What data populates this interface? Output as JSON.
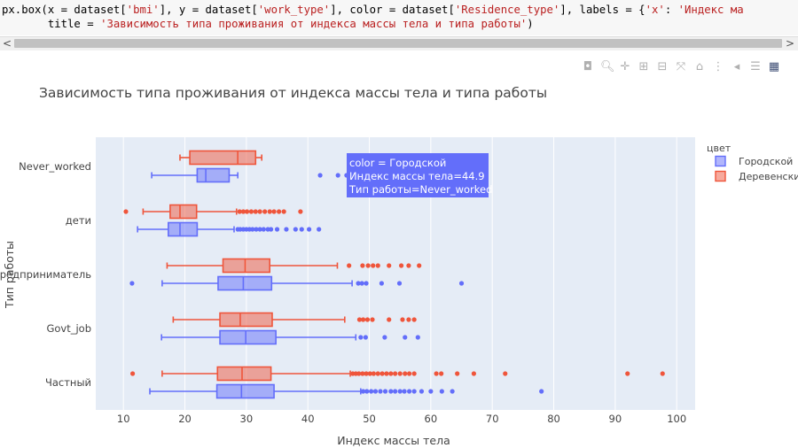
{
  "code": {
    "line1_pre": "px.box(x = dataset[",
    "line1_s1": "'bmi'",
    "line1_mid1": "], y = dataset[",
    "line1_s2": "'work_type'",
    "line1_mid2": "], color = dataset[",
    "line1_s3": "'Residence_type'",
    "line1_mid3": "], labels = {",
    "line1_s4": "'x'",
    "line1_mid4": ": ",
    "line1_s5": "'Индекс ма",
    "line2_pre": "       title = ",
    "line2_s": "'Зависимость типа проживания от индекса массы тела и типа работы'",
    "line2_post": ")"
  },
  "scroll": {
    "left_arrow": "<",
    "right_arrow": ">"
  },
  "modebar": [
    "camera-icon",
    "zoom-icon",
    "pan-icon",
    "zoom-in-icon",
    "zoom-out-icon",
    "autoscale-icon",
    "reset-axes-icon",
    "spike-lines-icon",
    "hover-closest-icon",
    "hover-compare-icon",
    "plotly-logo-icon"
  ],
  "tooltip": {
    "line1": "color = Городской",
    "line2": "Индекс массы тела=44.9",
    "line3": "Тип работы=Never_worked"
  },
  "chart_data": {
    "type": "box",
    "orientation": "horizontal",
    "title": "Зависимость типа проживания от индекса массы тела и типа работы",
    "xlabel": "Индекс массы тела",
    "ylabel": "Тип работы",
    "xlim": [
      5.5,
      103
    ],
    "xticks": [
      10,
      20,
      30,
      40,
      50,
      60,
      70,
      80,
      90,
      100
    ],
    "categories": [
      "Never_worked",
      "дети",
      "Предприниматель",
      "Govt_job",
      "Частный"
    ],
    "category_labels": [
      "Never_worked",
      "дети",
      "Предприниматель",
      "Govt_job",
      "Частный"
    ],
    "legend": {
      "title": "цвет",
      "placement": "right"
    },
    "series": [
      {
        "name": "Городской",
        "color": "#636efa",
        "boxes": [
          {
            "category": "Never_worked",
            "whisker_low": 14.6,
            "q1": 22.0,
            "median": 23.4,
            "q3": 27.2,
            "whisker_high": 28.6,
            "outliers": [
              42.0,
              44.9,
              46.3
            ]
          },
          {
            "category": "дети",
            "whisker_low": 12.3,
            "q1": 17.3,
            "median": 19.2,
            "q3": 22.0,
            "whisker_high": 28.0,
            "outliers": [
              28.6,
              29.0,
              29.5,
              30.0,
              30.5,
              31.0,
              31.6,
              32.2,
              32.8,
              33.5,
              34.0,
              35.0,
              36.5,
              38.0,
              39.0,
              40.2,
              41.8
            ]
          },
          {
            "category": "Предприниматель",
            "whisker_low": 16.3,
            "q1": 25.4,
            "median": 29.5,
            "q3": 34.1,
            "whisker_high": 47.2,
            "outliers": [
              11.4,
              48.2,
              48.8,
              49.5,
              52.0,
              54.9,
              65.0
            ]
          },
          {
            "category": "Govt_job",
            "whisker_low": 16.2,
            "q1": 25.7,
            "median": 29.9,
            "q3": 34.8,
            "whisker_high": 47.8,
            "outliers": [
              48.6,
              49.4,
              52.5,
              55.8,
              57.9
            ]
          },
          {
            "category": "Частный",
            "whisker_low": 14.3,
            "q1": 25.2,
            "median": 29.2,
            "q3": 34.5,
            "whisker_high": 48.6,
            "outliers": [
              49.0,
              49.6,
              50.3,
              51.0,
              51.8,
              52.6,
              53.5,
              54.2,
              55.0,
              55.7,
              56.5,
              57.3,
              58.5,
              60.0,
              61.8,
              63.5,
              78.0
            ]
          }
        ]
      },
      {
        "name": "Деревенский",
        "color": "#ef553b",
        "boxes": [
          {
            "category": "Never_worked",
            "whisker_low": 19.2,
            "q1": 20.8,
            "median": 28.6,
            "q3": 31.5,
            "whisker_high": 32.5,
            "outliers": []
          },
          {
            "category": "дети",
            "whisker_low": 13.2,
            "q1": 17.6,
            "median": 19.2,
            "q3": 21.9,
            "whisker_high": 28.4,
            "outliers": [
              10.4,
              28.9,
              29.5,
              30.1,
              30.8,
              31.5,
              32.2,
              33.0,
              33.8,
              34.5,
              35.3,
              36.1,
              38.8
            ]
          },
          {
            "category": "Предприниматель",
            "whisker_low": 17.1,
            "q1": 26.2,
            "median": 29.8,
            "q3": 33.8,
            "whisker_high": 44.8,
            "outliers": [
              46.7,
              48.9,
              49.8,
              50.6,
              51.4,
              53.2,
              55.2,
              56.4,
              58.1
            ]
          },
          {
            "category": "Govt_job",
            "whisker_low": 18.1,
            "q1": 25.7,
            "median": 29.0,
            "q3": 34.2,
            "whisker_high": 46.0,
            "outliers": [
              48.4,
              49.0,
              49.7,
              50.5,
              53.2,
              55.4,
              56.4,
              57.3
            ]
          },
          {
            "category": "Частный",
            "whisker_low": 16.3,
            "q1": 25.3,
            "median": 29.3,
            "q3": 34.0,
            "whisker_high": 46.9,
            "outliers": [
              11.5,
              47.3,
              47.8,
              48.3,
              48.9,
              49.5,
              50.1,
              50.7,
              51.4,
              52.1,
              52.8,
              53.5,
              54.2,
              55.0,
              55.8,
              56.5,
              57.3,
              60.9,
              61.7,
              64.3,
              67.0,
              72.1,
              92.0,
              97.7
            ]
          }
        ]
      }
    ]
  }
}
